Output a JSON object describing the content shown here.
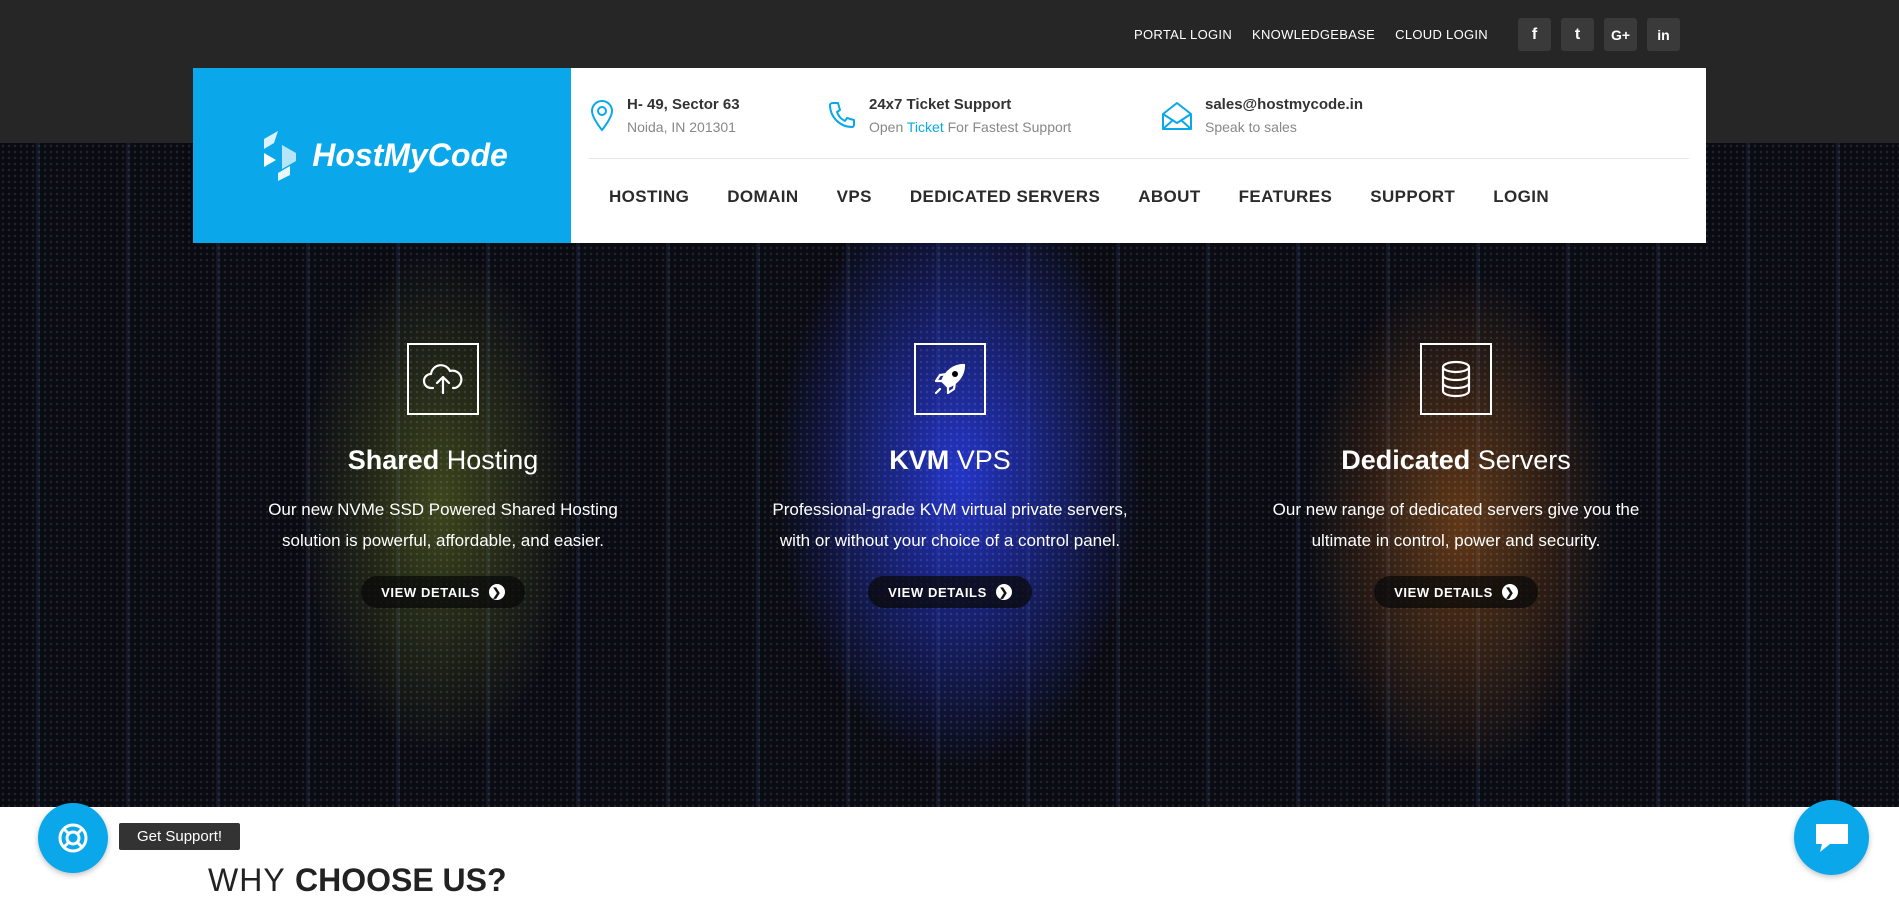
{
  "top_links": [
    "PORTAL LOGIN",
    "KNOWLEDGEBASE",
    "CLOUD LOGIN"
  ],
  "social": [
    {
      "glyph": "f",
      "icon": "facebook-icon"
    },
    {
      "glyph": "t",
      "icon": "twitter-icon"
    },
    {
      "glyph": "G+",
      "icon": "google-plus-icon"
    },
    {
      "glyph": "in",
      "icon": "linkedin-icon"
    }
  ],
  "logo": {
    "text": "HostMyCode",
    "icon": "hostmycode-logo-icon"
  },
  "contacts": {
    "address": {
      "title": "H- 49, Sector 63",
      "sub": "Noida, IN 201301",
      "icon": "location-pin-icon"
    },
    "support": {
      "title": "24x7 Ticket Support",
      "sub_prefix": "Open ",
      "sub_link": "Ticket",
      "sub_suffix": " For Fastest Support",
      "icon": "phone-icon"
    },
    "email": {
      "title": "sales@hostmycode.in",
      "sub": "Speak to sales",
      "icon": "envelope-icon"
    }
  },
  "nav": [
    "HOSTING",
    "DOMAIN",
    "VPS",
    "DEDICATED SERVERS",
    "ABOUT",
    "FEATURES",
    "SUPPORT",
    "LOGIN"
  ],
  "features": [
    {
      "title_bold": "Shared",
      "title_light": " Hosting",
      "desc_lines": [
        "Our new NVMe SSD Powered Shared Hosting",
        "solution is powerful, affordable, and easier."
      ],
      "button": "VIEW DETAILS",
      "icon": "cloud-upload-icon"
    },
    {
      "title_bold": "KVM",
      "title_light": " VPS",
      "desc_lines": [
        "Professional-grade KVM virtual private servers,",
        "with or without your choice of a control panel."
      ],
      "button": "VIEW DETAILS",
      "icon": "rocket-icon"
    },
    {
      "title_bold": "Dedicated",
      "title_light": " Servers",
      "desc_lines": [
        "Our new range of dedicated servers give you the",
        "ultimate in control, power and security."
      ],
      "button": "VIEW DETAILS",
      "icon": "database-icon"
    }
  ],
  "support_widget": {
    "label": "Get Support!",
    "icon": "lifebuoy-icon"
  },
  "chat_widget": {
    "icon": "chat-bubble-icon"
  },
  "why": {
    "light": "WHY ",
    "bold": "CHOOSE US?"
  },
  "colors": {
    "brand": "#0aa8ea",
    "topbar": "#262626",
    "text_dark": "#2b2b2b"
  }
}
